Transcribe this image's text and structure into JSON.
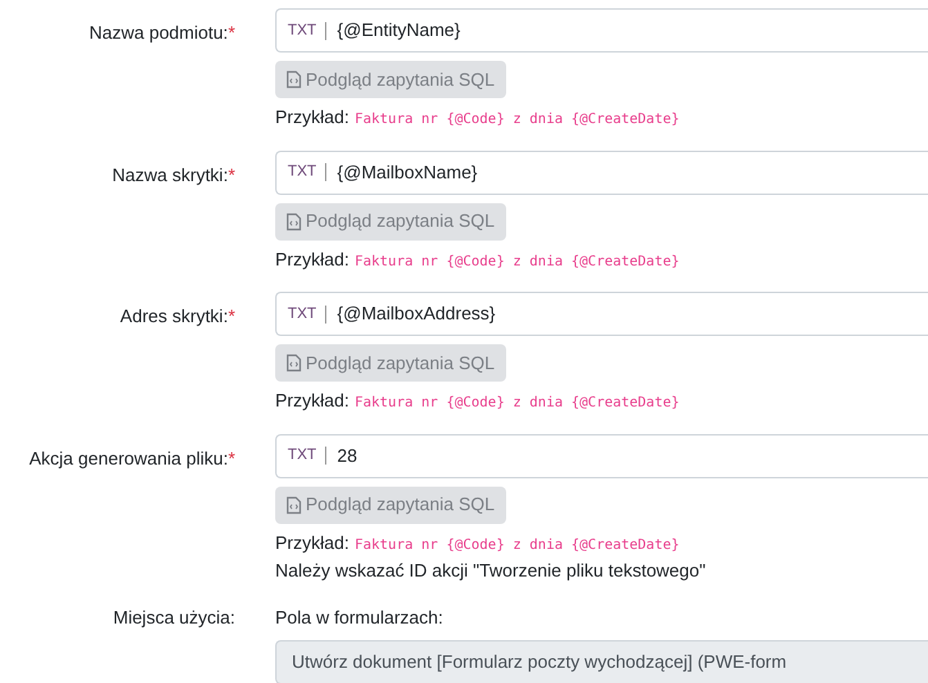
{
  "fields": [
    {
      "label": "Nazwa podmiotu:",
      "required_mark": "*",
      "type_tag": "TXT",
      "value": "{@EntityName}",
      "button": "Podgląd zapytania SQL",
      "example_label": "Przykład:",
      "example": "Faktura nr {@Code} z dnia {@CreateDate}"
    },
    {
      "label": "Nazwa skrytki:",
      "required_mark": "*",
      "type_tag": "TXT",
      "value": "{@MailboxName}",
      "button": "Podgląd zapytania SQL",
      "example_label": "Przykład:",
      "example": "Faktura nr {@Code} z dnia {@CreateDate}"
    },
    {
      "label": "Adres skrytki:",
      "required_mark": "*",
      "type_tag": "TXT",
      "value": "{@MailboxAddress}",
      "button": "Podgląd zapytania SQL",
      "example_label": "Przykład:",
      "example": "Faktura nr {@Code} z dnia {@CreateDate}"
    },
    {
      "label": "Akcja generowania pliku:",
      "required_mark": "*",
      "type_tag": "TXT",
      "value": "28",
      "button": "Podgląd zapytania SQL",
      "example_label": "Przykład:",
      "example": "Faktura nr {@Code} z dnia {@CreateDate}",
      "note": "Należy wskazać ID akcji \"Tworzenie pliku tekstowego\""
    }
  ],
  "usage": {
    "label": "Miejsca użycia:",
    "subtitle": "Pola w formularzach:",
    "items": [
      "Utwórz dokument [Formularz poczty wychodzącej] (PWE-form"
    ]
  }
}
